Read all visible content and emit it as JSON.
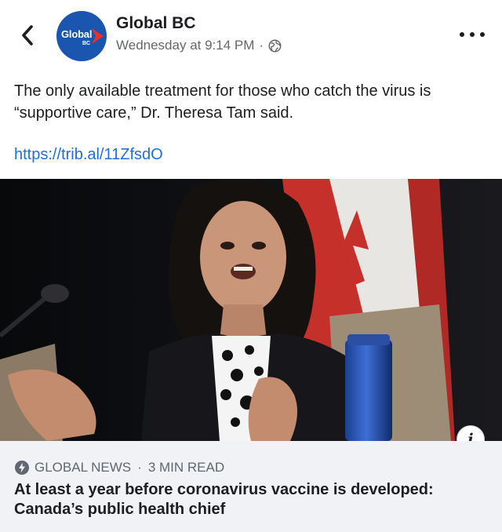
{
  "post": {
    "page_name": "Global BC",
    "timestamp": "Wednesday at 9:14 PM",
    "separator": "·",
    "audience_icon": "globe-icon",
    "text": "The only available  treatment for those who catch the virus is “supportive care,” Dr. Theresa Tam said.",
    "link": "https://trib.al/11ZfsdO"
  },
  "avatar": {
    "logo_text": "Global",
    "logo_sub": "BC",
    "brand_color": "#1a55b0",
    "accent_color": "#e8312b"
  },
  "link_card": {
    "source": "GLOBAL NEWS",
    "separator": "·",
    "read_time": "3 MIN READ",
    "headline": "At least a year before coronavirus vaccine is developed: Canada’s public health chief",
    "info_label": "i"
  },
  "icons": {
    "back": "chevron-left-icon",
    "more": "more-dots-icon",
    "source": "bolt-icon",
    "info": "info-icon"
  },
  "colors": {
    "link": "#216fdb",
    "meta": "#65676b",
    "card_bg": "#f0f2f5"
  }
}
